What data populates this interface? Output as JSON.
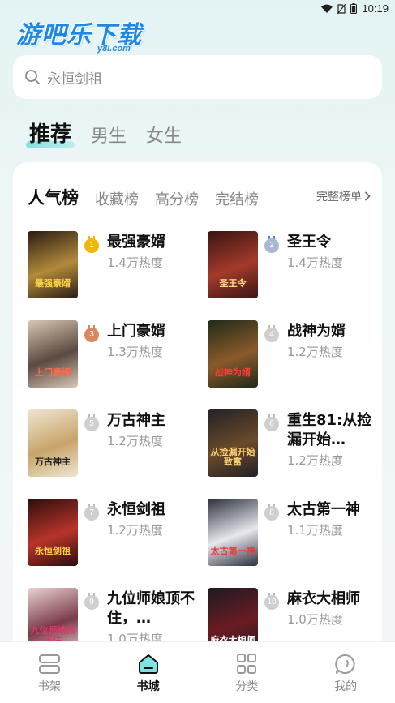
{
  "status": {
    "time": "10:19"
  },
  "logo": {
    "main": "游吧乐下载",
    "sub": "y8l.com"
  },
  "search": {
    "placeholder": "永恒剑祖"
  },
  "main_tabs": [
    {
      "label": "推荐",
      "active": true
    },
    {
      "label": "男生",
      "active": false
    },
    {
      "label": "女生",
      "active": false
    }
  ],
  "rank_tabs": [
    {
      "label": "人气榜",
      "active": true
    },
    {
      "label": "收藏榜",
      "active": false
    },
    {
      "label": "高分榜",
      "active": false
    },
    {
      "label": "完结榜",
      "active": false
    }
  ],
  "full_rank_label": "完整榜单",
  "books": [
    {
      "rank": "1",
      "title": "最强豪婿",
      "heat": "1.4万热度",
      "cover_text": "最强豪婿"
    },
    {
      "rank": "2",
      "title": "圣王令",
      "heat": "1.4万热度",
      "cover_text": "圣王令"
    },
    {
      "rank": "3",
      "title": "上门豪婿",
      "heat": "1.3万热度",
      "cover_text": "上门豪婿"
    },
    {
      "rank": "4",
      "title": "战神为婿",
      "heat": "1.2万热度",
      "cover_text": "战神为婿"
    },
    {
      "rank": "5",
      "title": "万古神主",
      "heat": "1.2万热度",
      "cover_text": "万古神主"
    },
    {
      "rank": "6",
      "title": "重生81:从捡漏开始…",
      "heat": "1.2万热度",
      "cover_text": "从捡漏开始致富"
    },
    {
      "rank": "7",
      "title": "永恒剑祖",
      "heat": "1.2万热度",
      "cover_text": "永恒剑祖"
    },
    {
      "rank": "8",
      "title": "太古第一神",
      "heat": "1.1万热度",
      "cover_text": "太古第一神"
    },
    {
      "rank": "9",
      "title": "九位师娘顶不住，…",
      "heat": "1.0万热度",
      "cover_text": "九位师娘顶不住"
    },
    {
      "rank": "10",
      "title": "麻衣大相师",
      "heat": "1.0万热度",
      "cover_text": "麻衣大相师"
    }
  ],
  "bottom_nav": [
    {
      "label": "书架",
      "icon": "bookshelf-icon",
      "active": false
    },
    {
      "label": "书城",
      "icon": "bookstore-icon",
      "active": true
    },
    {
      "label": "分类",
      "icon": "category-icon",
      "active": false
    },
    {
      "label": "我的",
      "icon": "profile-icon",
      "active": false
    }
  ],
  "colors": {
    "accent": "#7fe3e0",
    "gold": "#f2b705",
    "silver": "#b6c0cc",
    "bronze": "#d9875f",
    "grey_badge": "#cfcfcf"
  }
}
